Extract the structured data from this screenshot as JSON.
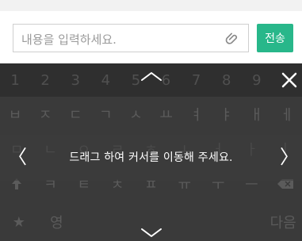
{
  "input_bar": {
    "placeholder": "내용을 입력하세요.",
    "send_label": "전송"
  },
  "keyboard": {
    "numbers": [
      "1",
      "2",
      "3",
      "4",
      "5",
      "6",
      "7",
      "8",
      "9"
    ],
    "row1": [
      "ㅂ",
      "ㅈ",
      "ㄷ",
      "ㄱ",
      "ㅅ",
      "ㅛ",
      "ㅕ",
      "ㅑ",
      "ㅐ",
      "ㅔ"
    ],
    "row2": [
      "ㅁ",
      "ㄴ",
      "ㅇ",
      "ㄹ",
      "ㅎ",
      "ㅗ",
      "ㅓ",
      "ㅏ",
      "ㅣ"
    ],
    "row3": [
      "ㅋ",
      "ㅌ",
      "ㅊ",
      "ㅍ",
      "ㅠ",
      "ㅜ",
      "ㅡ"
    ],
    "bottom": {
      "left": "★",
      "lang": "영",
      "enter": "다음"
    }
  },
  "overlay": {
    "hint": "드래그 하여 커서를 이동해 주세요.",
    "left_chevron": "〈",
    "right_chevron": "〉"
  },
  "icons": {
    "attach": "paperclip-icon",
    "close": "close-icon",
    "backspace": "backspace-icon",
    "shift": "shift-icon",
    "chevron_up": "chevron-up-icon",
    "chevron_down": "chevron-down-icon"
  },
  "colors": {
    "send": "#28b78a",
    "keyboard_bg": "#3a3a3a"
  }
}
